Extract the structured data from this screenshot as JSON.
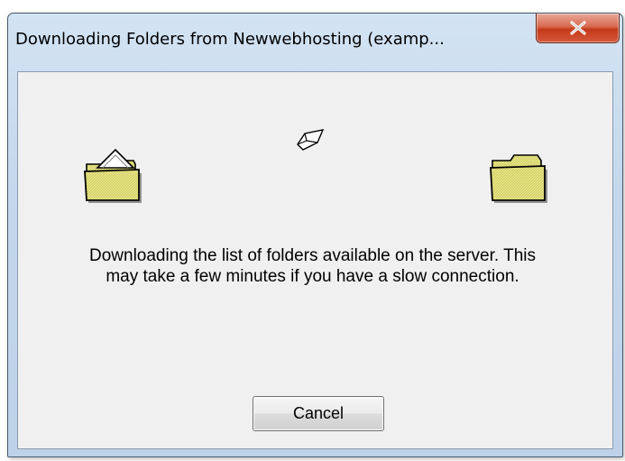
{
  "window": {
    "title": "Downloading Folders from Newwebhosting (examp..."
  },
  "title_bar": {
    "close_icon": "close-icon"
  },
  "animation": {
    "source_icon": "open-folder-icon",
    "flying_icon": "flying-document-icon",
    "destination_icon": "folder-icon"
  },
  "message": {
    "line1": "Downloading the list of folders available on the server. This",
    "line2": "may take a few minutes if you have a slow connection."
  },
  "buttons": {
    "cancel_label": "Cancel"
  },
  "colors": {
    "folder_fill": "#e8e680",
    "close_button": "#c4391a",
    "dialog_background": "#f0f0f0"
  }
}
